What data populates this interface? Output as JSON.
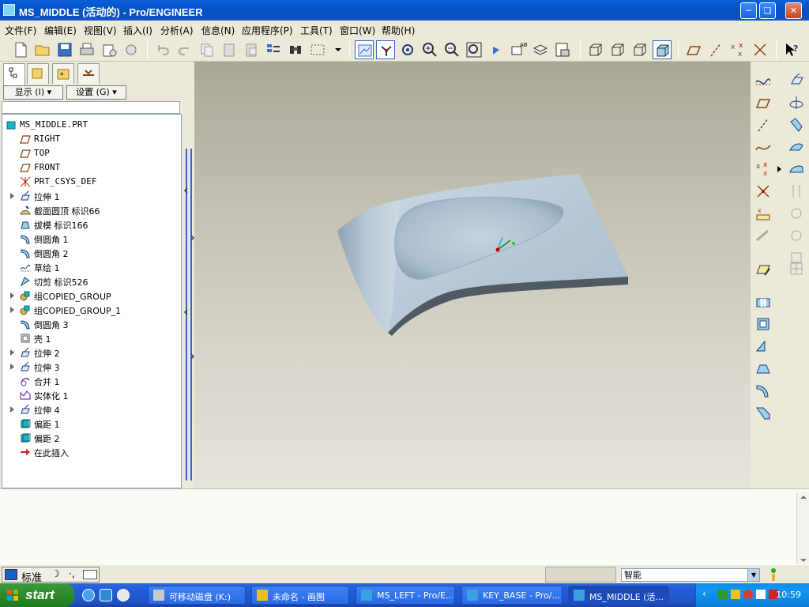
{
  "window": {
    "title": "MS_MIDDLE (活动的) - Pro/ENGINEER"
  },
  "menu": [
    "文件(F)",
    "编辑(E)",
    "视图(V)",
    "插入(I)",
    "分析(A)",
    "信息(N)",
    "应用程序(P)",
    "工具(T)",
    "窗口(W)",
    "帮助(H)"
  ],
  "left_panel": {
    "show_button": "显示 (I)",
    "settings_button": "设置 (G)"
  },
  "model_tree": [
    {
      "label": "MS_MIDDLE.PRT",
      "icon": "part-icon"
    },
    {
      "label": "RIGHT",
      "icon": "datum-plane-icon"
    },
    {
      "label": "TOP",
      "icon": "datum-plane-icon"
    },
    {
      "label": "FRONT",
      "icon": "datum-plane-icon"
    },
    {
      "label": "PRT_CSYS_DEF",
      "icon": "csys-icon"
    },
    {
      "label": "拉伸 1",
      "icon": "extrude-icon",
      "expandable": true
    },
    {
      "label": "截面圆顶 标识66",
      "icon": "dome-icon"
    },
    {
      "label": "拔模 标识166",
      "icon": "draft-icon"
    },
    {
      "label": "倒圆角 1",
      "icon": "round-icon"
    },
    {
      "label": "倒圆角 2",
      "icon": "round-icon"
    },
    {
      "label": "草绘 1",
      "icon": "sketch-icon"
    },
    {
      "label": "切剪 标识526",
      "icon": "cut-icon"
    },
    {
      "label": "组COPIED_GROUP",
      "icon": "group-icon",
      "expandable": true
    },
    {
      "label": "组COPIED_GROUP_1",
      "icon": "group-icon",
      "expandable": true
    },
    {
      "label": "倒圆角 3",
      "icon": "round-icon"
    },
    {
      "label": "壳 1",
      "icon": "shell-icon"
    },
    {
      "label": "拉伸 2",
      "icon": "extrude-icon",
      "expandable": true
    },
    {
      "label": "拉伸 3",
      "icon": "extrude-icon",
      "expandable": true
    },
    {
      "label": "合并 1",
      "icon": "merge-icon"
    },
    {
      "label": "实体化 1",
      "icon": "solidify-icon"
    },
    {
      "label": "拉伸 4",
      "icon": "extrude-icon",
      "expandable": true
    },
    {
      "label": "偏距 1",
      "icon": "offset-icon"
    },
    {
      "label": "偏距 2",
      "icon": "offset-icon"
    },
    {
      "label": "在此插入",
      "icon": "insert-here-arrow-icon"
    }
  ],
  "status": {
    "ime_label": "标准",
    "filter_value": "智能"
  },
  "taskbar": {
    "start_label": "start",
    "tasks": [
      {
        "label": "可移动磁盘 (K:)",
        "icon": "drive-icon"
      },
      {
        "label": "未命名 - 画图",
        "icon": "paint-icon"
      },
      {
        "label": "MS_LEFT - Pro/E...",
        "icon": "proe-icon"
      },
      {
        "label": "KEY_BASE - Pro/...",
        "icon": "proe-icon"
      },
      {
        "label": "MS_MIDDLE (活...",
        "icon": "proe-icon",
        "active": true
      }
    ],
    "clock": "10:59"
  }
}
